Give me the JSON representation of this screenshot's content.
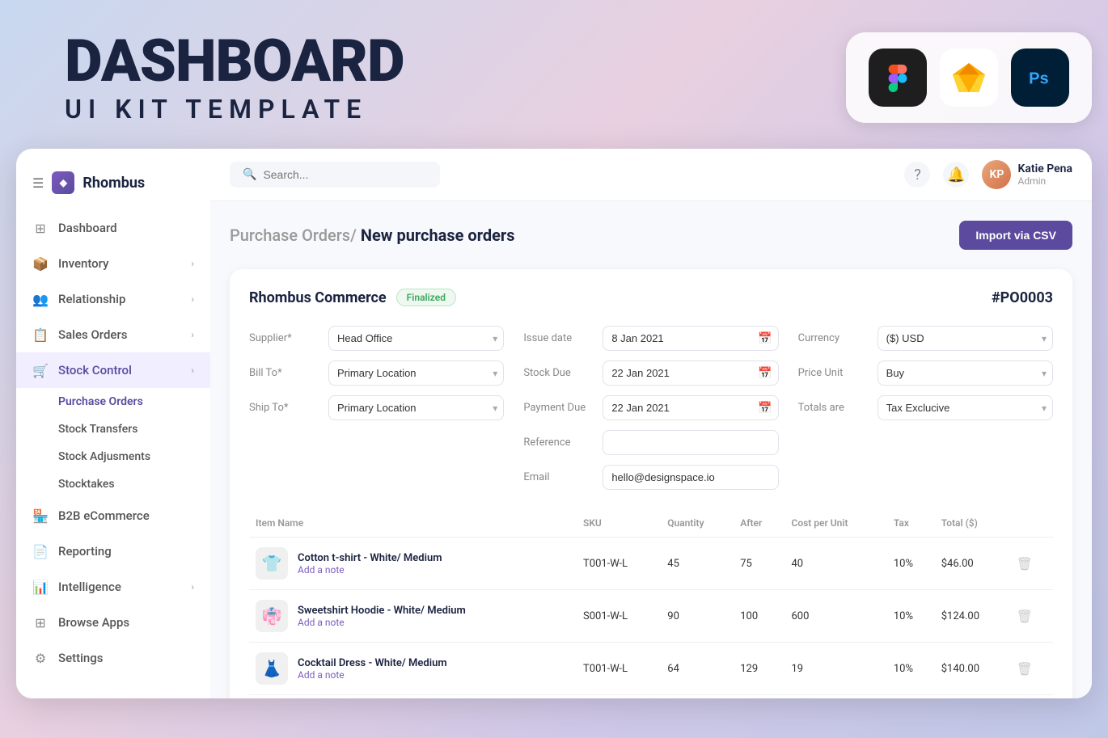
{
  "branding": {
    "title": "DASHBOARD",
    "subtitle": "UI KIT TEMPLATE"
  },
  "tools": [
    {
      "name": "Figma",
      "emoji": "🎨",
      "class": "figma"
    },
    {
      "name": "Sketch",
      "emoji": "💎",
      "class": "sketch"
    },
    {
      "name": "Photoshop",
      "emoji": "🖼",
      "class": "ps"
    }
  ],
  "sidebar": {
    "brand": "Rhombus",
    "nav_items": [
      {
        "label": "Dashboard",
        "icon": "⊞",
        "has_sub": false,
        "active": false
      },
      {
        "label": "Inventory",
        "icon": "📦",
        "has_sub": true,
        "active": false
      },
      {
        "label": "Relationship",
        "icon": "👥",
        "has_sub": true,
        "active": false
      },
      {
        "label": "Sales Orders",
        "icon": "📋",
        "has_sub": true,
        "active": false
      },
      {
        "label": "Stock Control",
        "icon": "🛒",
        "has_sub": true,
        "active": true
      }
    ],
    "sub_nav": [
      {
        "label": "Purchase Orders",
        "active": true
      },
      {
        "label": "Stock Transfers",
        "active": false
      },
      {
        "label": "Stock Adjusments",
        "active": false
      },
      {
        "label": "Stocktakes",
        "active": false
      }
    ],
    "nav_items_bottom": [
      {
        "label": "B2B eCommerce",
        "icon": "🏪",
        "has_sub": false,
        "active": false
      },
      {
        "label": "Reporting",
        "icon": "📄",
        "has_sub": false,
        "active": false
      },
      {
        "label": "Intelligence",
        "icon": "📊",
        "has_sub": true,
        "active": false
      },
      {
        "label": "Browse Apps",
        "icon": "⊞",
        "has_sub": false,
        "active": false
      },
      {
        "label": "Settings",
        "icon": "⚙",
        "has_sub": false,
        "active": false
      }
    ]
  },
  "topbar": {
    "search_placeholder": "Search...",
    "user": {
      "name": "Katie Pena",
      "role": "Admin",
      "initials": "KP"
    }
  },
  "page": {
    "breadcrumb_parent": "Purchase Orders/",
    "breadcrumb_current": "New purchase orders",
    "import_button": "Import via CSV"
  },
  "po": {
    "company": "Rhombus Commerce",
    "status": "Finalized",
    "number": "#PO0003",
    "supplier_label": "Supplier*",
    "supplier_value": "Head Office",
    "bill_to_label": "Bill To*",
    "bill_to_value": "Primary Location",
    "ship_to_label": "Ship To*",
    "ship_to_value": "Primary Location",
    "issue_date_label": "Issue date",
    "issue_date_value": "8 Jan 2021",
    "stock_due_label": "Stock Due",
    "stock_due_value": "22 Jan 2021",
    "payment_due_label": "Payment Due",
    "payment_due_value": "22 Jan 2021",
    "reference_label": "Reference",
    "reference_value": "",
    "email_label": "Email",
    "email_value": "hello@designspace.io",
    "currency_label": "Currency",
    "currency_value": "($) USD",
    "price_unit_label": "Price Unit",
    "price_unit_value": "Buy",
    "totals_label": "Totals are",
    "totals_value": "Tax Exclucive"
  },
  "table": {
    "headers": [
      "Item Name",
      "SKU",
      "Quantity",
      "After",
      "Cost per Unit",
      "Tax",
      "Total ($)"
    ],
    "rows": [
      {
        "name": "Cotton t-shirt - White/ Medium",
        "note": "Add a note",
        "sku": "T001-W-L",
        "quantity": "45",
        "after": "75",
        "cost": "40",
        "tax": "10%",
        "total": "$46.00",
        "thumb": "👕"
      },
      {
        "name": "Sweetshirt Hoodie - White/ Medium",
        "note": "Add a note",
        "sku": "S001-W-L",
        "quantity": "90",
        "after": "100",
        "cost": "600",
        "tax": "10%",
        "total": "$124.00",
        "thumb": "👘"
      },
      {
        "name": "Cocktail Dress - White/ Medium",
        "note": "Add a note",
        "sku": "T001-W-L",
        "quantity": "64",
        "after": "129",
        "cost": "19",
        "tax": "10%",
        "total": "$140.00",
        "thumb": "👗"
      }
    ]
  }
}
